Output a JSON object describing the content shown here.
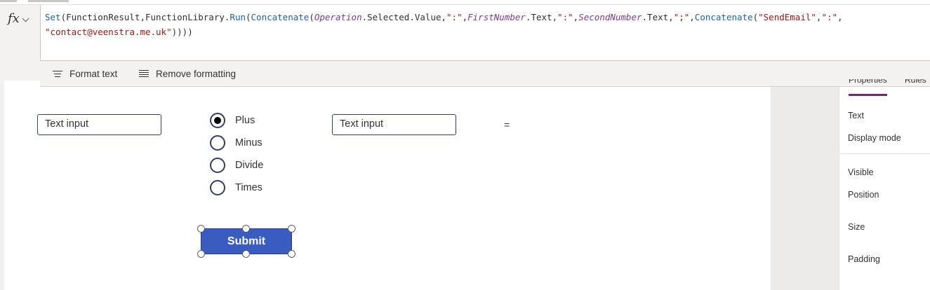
{
  "formula_bar": {
    "fx_label": "fx",
    "tokens": [
      {
        "t": "Set",
        "c": "fn"
      },
      {
        "t": "(",
        "c": "p"
      },
      {
        "t": "FunctionResult",
        "c": "p"
      },
      {
        "t": ",",
        "c": "p"
      },
      {
        "t": "FunctionLibrary",
        "c": "p"
      },
      {
        "t": ".",
        "c": "p"
      },
      {
        "t": "Run",
        "c": "fn"
      },
      {
        "t": "(",
        "c": "p"
      },
      {
        "t": "Concatenate",
        "c": "fn"
      },
      {
        "t": "(",
        "c": "p"
      },
      {
        "t": "Operation",
        "c": "ctrl"
      },
      {
        "t": ".Selected.Value",
        "c": "prop"
      },
      {
        "t": ",",
        "c": "p"
      },
      {
        "t": "\":\"",
        "c": "str"
      },
      {
        "t": ",",
        "c": "p"
      },
      {
        "t": "FirstNumber",
        "c": "ctrl"
      },
      {
        "t": ".Text",
        "c": "prop"
      },
      {
        "t": ",",
        "c": "p"
      },
      {
        "t": "\":\"",
        "c": "str"
      },
      {
        "t": ",",
        "c": "p"
      },
      {
        "t": "SecondNumber",
        "c": "ctrl"
      },
      {
        "t": ".Text",
        "c": "prop"
      },
      {
        "t": ",",
        "c": "p"
      },
      {
        "t": "\";\"",
        "c": "str"
      },
      {
        "t": ",",
        "c": "p"
      },
      {
        "t": "Concatenate",
        "c": "fn"
      },
      {
        "t": "(",
        "c": "p"
      },
      {
        "t": "\"SendEmail\"",
        "c": "str"
      },
      {
        "t": ",",
        "c": "p"
      },
      {
        "t": "\":\"",
        "c": "str"
      },
      {
        "t": ",",
        "c": "p"
      },
      {
        "t": "\n",
        "c": "p"
      },
      {
        "t": "\"contact@veenstra.me.uk\"",
        "c": "str"
      },
      {
        "t": "))))",
        "c": "p"
      }
    ]
  },
  "format_bar": {
    "format_text": "Format text",
    "remove_formatting": "Remove formatting"
  },
  "canvas": {
    "first_input_placeholder": "Text input",
    "second_input_placeholder": "Text input",
    "equals": "=",
    "radio_options": [
      {
        "label": "Plus",
        "selected": true
      },
      {
        "label": "Minus",
        "selected": false
      },
      {
        "label": "Divide",
        "selected": false
      },
      {
        "label": "Times",
        "selected": false
      }
    ],
    "submit_label": "Submit"
  },
  "right_panel": {
    "tabs": [
      "Properties",
      "Rules"
    ],
    "properties": [
      "Text",
      "Display mode",
      "Visible",
      "Position",
      "Size",
      "Padding"
    ]
  },
  "colors": {
    "accent": "#742774",
    "button": "#3a5bbf",
    "input_border": "#2f3d6b"
  }
}
